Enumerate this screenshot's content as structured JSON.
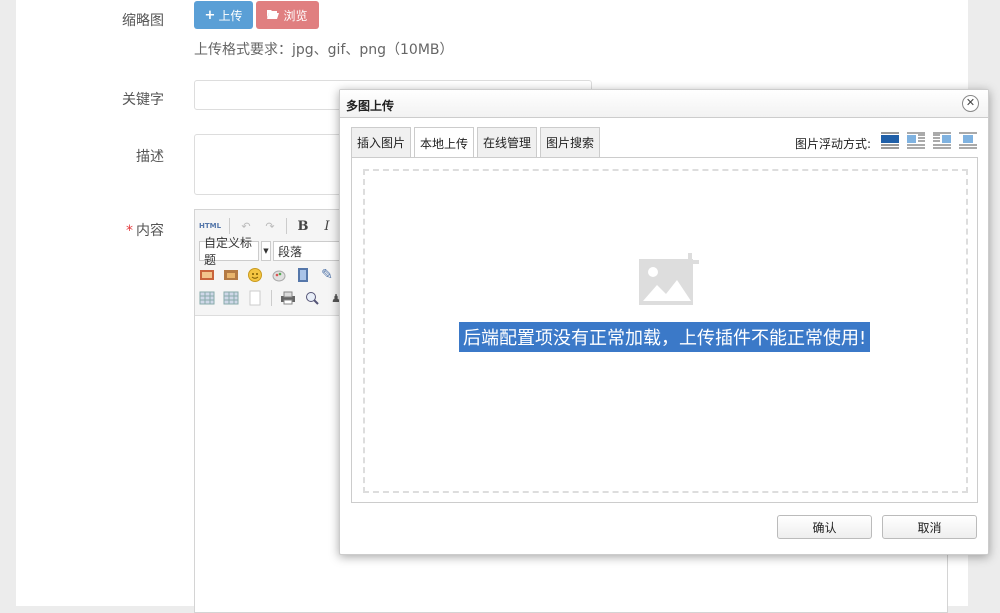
{
  "form": {
    "thumbnail_label": "缩略图",
    "upload_button": "上传",
    "browse_button": "浏览",
    "format_hint": "上传格式要求：jpg、gif、png（10MB）",
    "keywords_label": "关键字",
    "description_label": "描述",
    "content_required_mark": "*",
    "content_label": "内容"
  },
  "editor": {
    "html_button": "HTML",
    "heading_select": "自定义标题",
    "paragraph_select": "段落",
    "toolbar_icons": [
      "html-icon",
      "undo-icon",
      "redo-icon",
      "bold-icon",
      "italic-icon",
      "image-icon",
      "picture-icon",
      "emoticon-icon",
      "scrawl-icon",
      "video-icon",
      "attachment-icon",
      "table-icon",
      "table-grid-icon",
      "blank-page-icon",
      "print-icon",
      "preview-icon",
      "search-replace-icon"
    ]
  },
  "dialog": {
    "title": "多图上传",
    "close_icon": "close-icon",
    "tabs": [
      {
        "label": "插入图片"
      },
      {
        "label": "本地上传"
      },
      {
        "label": "在线管理"
      },
      {
        "label": "图片搜索"
      }
    ],
    "active_tab": "本地上传",
    "float_label": "图片浮动方式:",
    "float_options": [
      "float-none-icon",
      "float-left-icon",
      "float-right-icon",
      "float-center-icon"
    ],
    "error_message": "后端配置项没有正常加载，上传插件不能正常使用!",
    "confirm_button": "确认",
    "cancel_button": "取消"
  },
  "colors": {
    "upload_button": "#5a9fd6",
    "browse_button": "#e07f80",
    "error_highlight": "#3b79c8",
    "required": "#e4393c"
  }
}
